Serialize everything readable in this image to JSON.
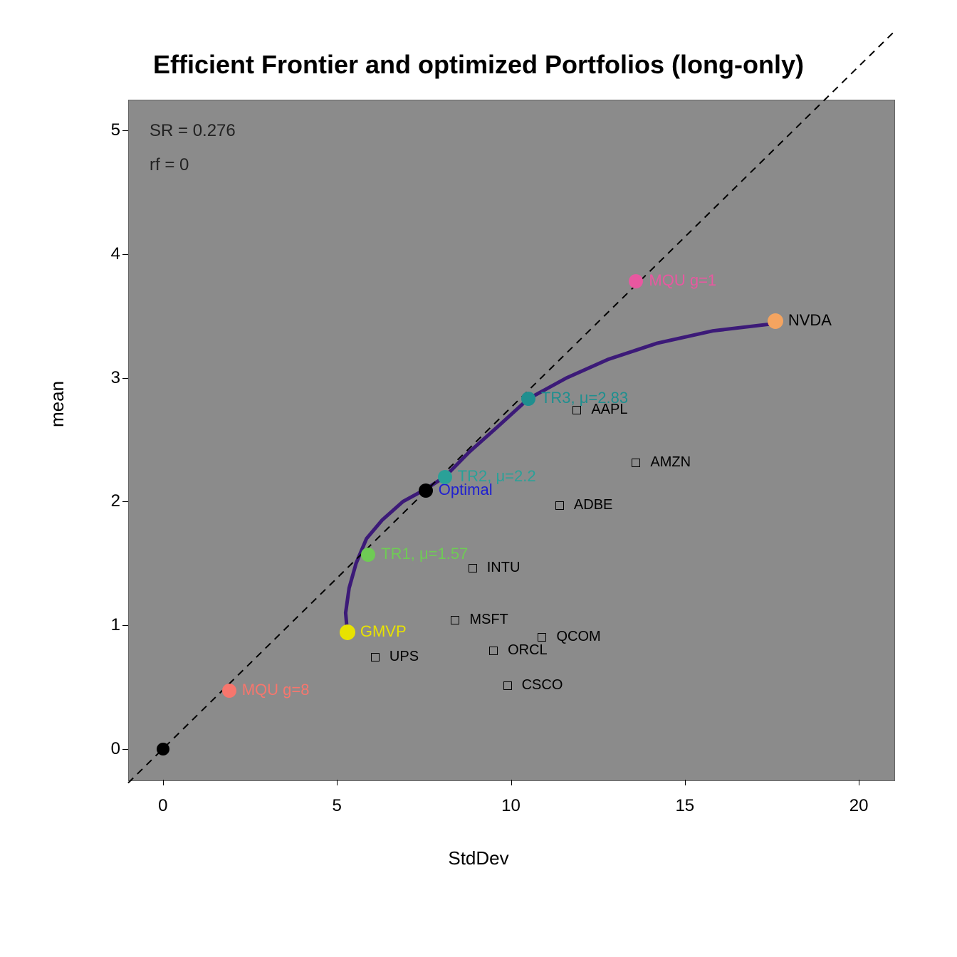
{
  "chart_data": {
    "type": "scatter",
    "title": "Efficient Frontier and optimized Portfolios (long-only)",
    "xlabel": "StdDev",
    "ylabel": "mean",
    "xlim": [
      -1,
      21
    ],
    "ylim": [
      -0.25,
      5.25
    ],
    "x_ticks": [
      0,
      5,
      10,
      15,
      20
    ],
    "y_ticks": [
      0,
      1,
      2,
      3,
      4,
      5
    ],
    "info": {
      "sr_label": "SR = 0.276",
      "rf_label": "rf = 0"
    },
    "capital_market_line": {
      "intercept": 0,
      "slope": 0.276,
      "style": "dashed",
      "color": "#000000"
    },
    "efficient_frontier": {
      "color": "#3C1A78",
      "points": [
        {
          "x": 5.3,
          "y": 0.94
        },
        {
          "x": 5.25,
          "y": 1.1
        },
        {
          "x": 5.35,
          "y": 1.3
        },
        {
          "x": 5.55,
          "y": 1.5
        },
        {
          "x": 5.85,
          "y": 1.7
        },
        {
          "x": 6.3,
          "y": 1.85
        },
        {
          "x": 6.9,
          "y": 2.0
        },
        {
          "x": 7.55,
          "y": 2.1
        },
        {
          "x": 8.1,
          "y": 2.2
        },
        {
          "x": 8.8,
          "y": 2.4
        },
        {
          "x": 9.6,
          "y": 2.6
        },
        {
          "x": 10.5,
          "y": 2.83
        },
        {
          "x": 11.6,
          "y": 3.0
        },
        {
          "x": 12.8,
          "y": 3.15
        },
        {
          "x": 14.2,
          "y": 3.28
        },
        {
          "x": 15.8,
          "y": 3.38
        },
        {
          "x": 17.6,
          "y": 3.44
        }
      ]
    },
    "portfolios": [
      {
        "name": "origin",
        "label": "",
        "x": 0.0,
        "y": 0.0,
        "color": "#000000",
        "label_color": "#000000",
        "r": 9
      },
      {
        "name": "mqu-g8",
        "label": "MQU g=8",
        "x": 1.9,
        "y": 0.47,
        "color": "#F7766D",
        "label_color": "#F7766D",
        "r": 10
      },
      {
        "name": "gmvp",
        "label": "GMVP",
        "x": 5.3,
        "y": 0.94,
        "color": "#E8E200",
        "label_color": "#E8E200",
        "r": 11
      },
      {
        "name": "tr1",
        "label": "TR1, μ=1.57",
        "x": 5.9,
        "y": 1.57,
        "color": "#6FCB55",
        "label_color": "#6FCB55",
        "r": 10
      },
      {
        "name": "optimal",
        "label": "Optimal",
        "x": 7.55,
        "y": 2.09,
        "color": "#000000",
        "label_color": "#2020D0",
        "r": 10
      },
      {
        "name": "tr2",
        "label": "TR2, μ=2.2",
        "x": 8.1,
        "y": 2.2,
        "color": "#2AA198",
        "label_color": "#2AA198",
        "r": 10
      },
      {
        "name": "tr3",
        "label": "TR3, μ=2.83",
        "x": 10.5,
        "y": 2.83,
        "color": "#1F8F8F",
        "label_color": "#1F8F8F",
        "r": 10
      },
      {
        "name": "nvda",
        "label": "NVDA",
        "x": 17.6,
        "y": 3.46,
        "color": "#F4A460",
        "label_color": "#000000",
        "r": 11
      },
      {
        "name": "mqu-g1",
        "label": "MQU g=1",
        "x": 13.6,
        "y": 3.78,
        "color": "#E858A0",
        "label_color": "#E858A0",
        "r": 10
      }
    ],
    "assets": [
      {
        "ticker": "AAPL",
        "x": 11.9,
        "y": 2.74
      },
      {
        "ticker": "AMZN",
        "x": 13.6,
        "y": 2.31
      },
      {
        "ticker": "ADBE",
        "x": 11.4,
        "y": 1.97
      },
      {
        "ticker": "INTU",
        "x": 8.9,
        "y": 1.46
      },
      {
        "ticker": "MSFT",
        "x": 8.4,
        "y": 1.04
      },
      {
        "ticker": "QCOM",
        "x": 10.9,
        "y": 0.9
      },
      {
        "ticker": "ORCL",
        "x": 9.5,
        "y": 0.79
      },
      {
        "ticker": "UPS",
        "x": 6.1,
        "y": 0.74
      },
      {
        "ticker": "CSCO",
        "x": 9.9,
        "y": 0.51
      }
    ]
  }
}
